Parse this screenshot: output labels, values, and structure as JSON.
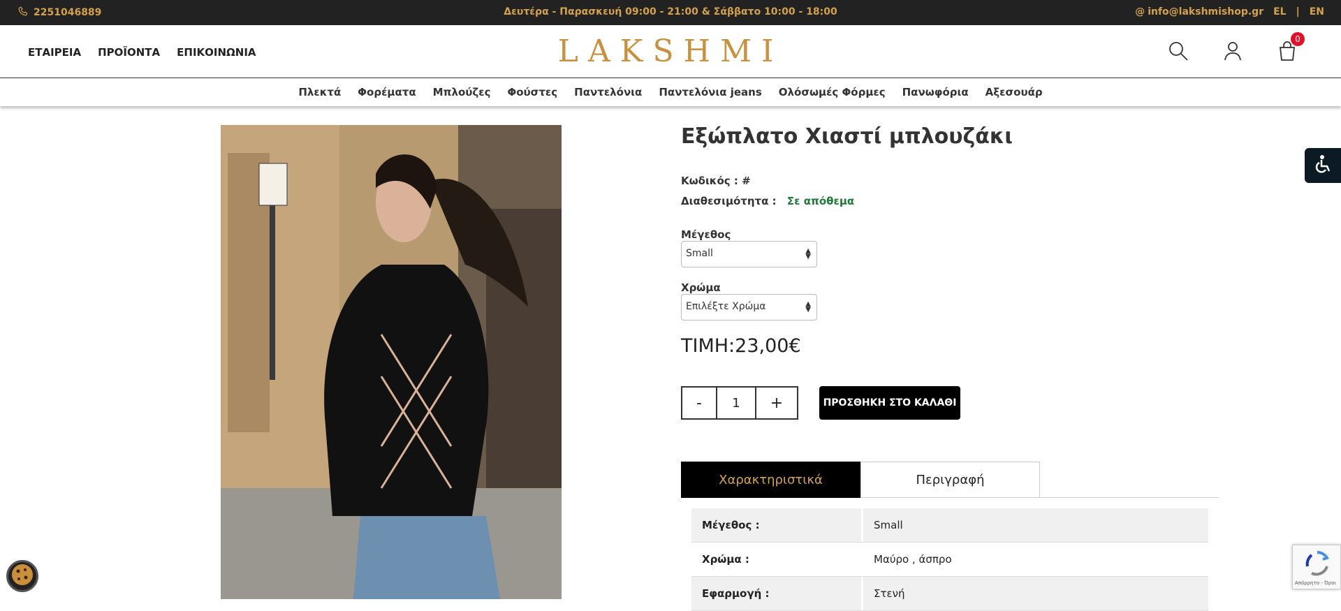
{
  "topbar": {
    "phone": "2251046889",
    "hours": "Δευτέρα - Παρασκευή 09:00 - 21:00 & Σάββατο 10:00 - 18:00",
    "email": "info@lakshmishop.gr",
    "lang_el": "EL",
    "lang_sep": "|",
    "lang_en": "EN",
    "accent_color": "#d4a24c"
  },
  "header": {
    "nav": [
      "ΕΤΑΙΡΕΙΑ",
      "ΠΡΟΪΟΝΤΑ",
      "ΕΠΙΚΟΙΝΩΝΙΑ"
    ],
    "logo": "LAKSHMI",
    "cart_count": "0",
    "icons": [
      "search-icon",
      "user-icon",
      "cart-icon"
    ]
  },
  "categories": [
    "Πλεκτά",
    "Φορέματα",
    "Μπλούζες",
    "Φούστες",
    "Παντελόνια",
    "Παντελόνια jeans",
    "Ολόσωμές Φόρμες",
    "Πανωφόρια",
    "Αξεσουάρ"
  ],
  "product": {
    "title": "Εξώπλατο Χιαστί μπλουζάκι",
    "code_label": "Κωδικός : #",
    "availability_label": "Διαθεσιμότητα :",
    "availability_value": "Σε απόθεμα",
    "size_label": "Μέγεθος",
    "size_value": "Small",
    "color_label": "Χρώμα",
    "color_value": "Επιλέξτε Χρώμα",
    "price_label": "ΤΙΜΗ:",
    "price_value": "23,00€",
    "qty_minus": "-",
    "qty_value": "1",
    "qty_plus": "+",
    "add_to_cart": "ΠΡΟΣΘΗΚΗ ΣΤΟ ΚΑΛΑΘΙ"
  },
  "tabs": {
    "features": "Χαρακτηριστικά",
    "description": "Περιγραφή"
  },
  "specs": [
    {
      "key": "Μέγεθος :",
      "value": "Small"
    },
    {
      "key": "Χρώμα :",
      "value": "Μαύρο , άσπρο"
    },
    {
      "key": "Εφαρμογή :",
      "value": "Στενή"
    }
  ],
  "recaptcha": {
    "text": "Απόρρητο - Όροι"
  }
}
